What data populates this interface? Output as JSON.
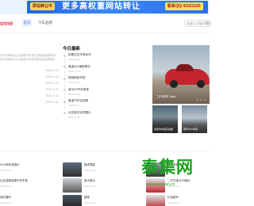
{
  "banner": {
    "tag": "原站转让中",
    "slogan": "更多高权重网站转让",
    "contact": "联系QQ:41023155"
  },
  "header": {
    "logo": "ome",
    "nav": [
      "首页",
      "汽车品牌"
    ],
    "search_placeholder": "请输入关键词搜索"
  },
  "left": {
    "title": "",
    "desc": "总车讯网每日汇总最新汽车资讯 报道及最新资讯, 总车讯网每日汇总最新汽车资讯报道及最新资讯",
    "items": [
      {
        "title": "",
        "date": "2020-11-11"
      },
      {
        "title": "",
        "date": "2020-11-11"
      },
      {
        "title": "",
        "date": "2020-11-11"
      },
      {
        "title": "",
        "date": "2020-11-11"
      },
      {
        "title": "",
        "date": "2020-11-11"
      },
      {
        "title": "",
        "date": "2020-11-11"
      }
    ]
  },
  "news": {
    "title": "今日最新",
    "items": [
      {
        "title": "特斯拉在华电动车",
        "date": "2020-11-11"
      },
      {
        "title": "奥迪A4L最新报价",
        "date": "2020-11-11"
      },
      {
        "title": "奔驰新款车型",
        "date": "2020-11-11"
      },
      {
        "title": "宝马X5汽车新款",
        "date": "2020-11-11"
      },
      {
        "title": "奥迪汽车实拍图",
        "date": "2020-11-11"
      },
      {
        "title": "比亚迪汉实拍图片",
        "date": "2020-11-11"
      }
    ]
  },
  "feature": {
    "caption": "二手车型号 Tesla",
    "thumbs": [
      "全新款车型实拍图",
      "豪华SUV车型"
    ]
  },
  "bottom": [
    {
      "title": "SUV新车型报价",
      "date": "2020-11-11"
    },
    {
      "title": "路虎揽胜",
      "date": "2020-11-11"
    },
    {
      "title": "奔驰新款",
      "date": "2020-11-11"
    },
    {
      "title": "比亚迪新能源汽车车型",
      "date": "2020-11-11"
    },
    {
      "title": "宝马报价",
      "date": "2020-11-11"
    },
    {
      "title": "二手车宝马X5报价",
      "date": "2020-11-11"
    },
    {
      "title": "保时捷车",
      "date": "2020-11-11"
    },
    {
      "title": "新款",
      "date": "2020-11-11"
    },
    {
      "title": "红色跑车",
      "date": "2020-11-11"
    }
  ],
  "watermark": {
    "text": "泰集网",
    "url": "www.taoyuan.cn"
  }
}
